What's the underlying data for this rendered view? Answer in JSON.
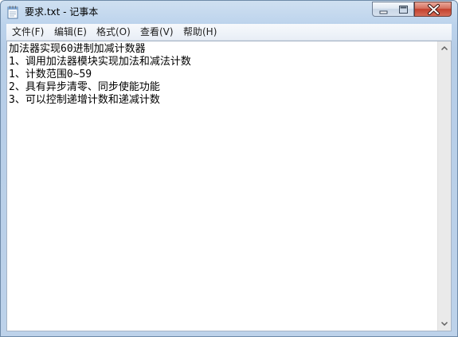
{
  "window": {
    "title": "要求.txt - 记事本"
  },
  "menu": {
    "items": [
      {
        "label": "文件(F)"
      },
      {
        "label": "编辑(E)"
      },
      {
        "label": "格式(O)"
      },
      {
        "label": "查看(V)"
      },
      {
        "label": "帮助(H)"
      }
    ]
  },
  "document": {
    "content": "加法器实现60进制加减计数器\n1、调用加法器模块实现加法和减法计数\n1、计数范围0~59\n2、具有异步清零、同步使能功能\n3、可以控制递增计数和递减计数"
  },
  "colors": {
    "titlebar": "#bcd3ec",
    "close_button": "#c4402c",
    "menubar": "#f0f4f9",
    "editor_bg": "#ffffff"
  }
}
